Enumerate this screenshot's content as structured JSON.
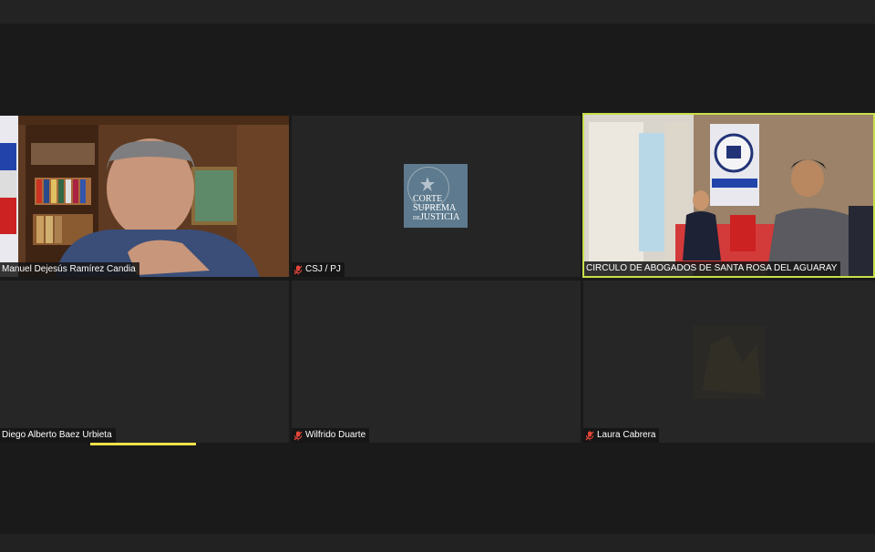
{
  "meeting": {
    "participants": [
      {
        "name": "Manuel Dejesús Ramírez Candia",
        "muted": false,
        "video": true,
        "active_speaker": false
      },
      {
        "name": "CSJ / PJ",
        "muted": true,
        "video": false,
        "logo": true
      },
      {
        "name": "CIRCULO DE ABOGADOS DE SANTA ROSA DEL AGUARAY",
        "muted": false,
        "video": true,
        "active_speaker": true
      },
      {
        "name": "Diego Alberto Baez Urbieta",
        "muted": false,
        "video": false
      },
      {
        "name": "Wilfrido Duarte",
        "muted": true,
        "video": false
      },
      {
        "name": "Laura Cabrera",
        "muted": true,
        "video": false
      }
    ],
    "logo": {
      "line1": "CORTE",
      "line2": "SUPREMA",
      "line3": "JUSTICIA",
      "prefix": "DE"
    }
  },
  "colors": {
    "active_border": "#c8e04a",
    "muted_icon": "#e8463a",
    "logo_bg": "#5d7a8e"
  },
  "icons": [
    "microphone-muted-icon"
  ]
}
